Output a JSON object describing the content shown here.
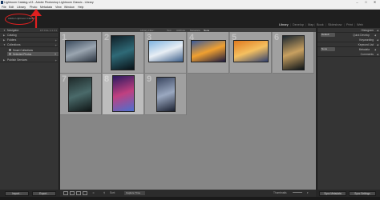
{
  "window": {
    "title": "Lightroom Catalog-v13 - Adobe Photoshop Lightroom Classic - Library",
    "min": "–",
    "max": "□",
    "close": "✕"
  },
  "menu": [
    "File",
    "Edit",
    "Library",
    "Photo",
    "Metadata",
    "View",
    "Window",
    "Help"
  ],
  "identity_plate": {
    "text": "Adobe Lightroom Classic"
  },
  "modules": [
    "Library",
    "Develop",
    "Map",
    "Book",
    "Slideshow",
    "Print",
    "Web"
  ],
  "active_module": "Library",
  "left_panel": {
    "navigator": {
      "label": "Navigator",
      "options": "FIT  FILL  1:1  3:1"
    },
    "catalog": {
      "label": "Catalog"
    },
    "folders": {
      "label": "Folders"
    },
    "collections": {
      "label": "Collections",
      "items": [
        {
          "label": "Smart Collections",
          "count": ""
        },
        {
          "label": "Selected Photos",
          "count": "9"
        }
      ]
    },
    "publish": {
      "label": "Publish Services"
    },
    "import_label": "Import...",
    "export_label": "Export..."
  },
  "filter_bar": {
    "title": "Library Filter :",
    "options": [
      "Text",
      "Attribute",
      "Metadata",
      "None"
    ],
    "active": "None"
  },
  "grid": {
    "cells": [
      {
        "num": "1",
        "palette": [
          "#3a4a5c",
          "#9aa5b0",
          "#2b3440"
        ]
      },
      {
        "num": "2",
        "palette": [
          "#0f1e26",
          "#2f6a77",
          "#081015"
        ]
      },
      {
        "num": "3",
        "palette": [
          "#7fb3e0",
          "#e8eef4",
          "#3d5f8a"
        ]
      },
      {
        "num": "4",
        "palette": [
          "#3a5a9a",
          "#f0a030",
          "#1a1a40"
        ]
      },
      {
        "num": "5",
        "palette": [
          "#e07a20",
          "#f5c060",
          "#304070"
        ]
      },
      {
        "num": "6",
        "palette": [
          "#1a2630",
          "#c8a060",
          "#0a1218"
        ]
      },
      {
        "num": "7",
        "palette": [
          "#1e2a2a",
          "#4a6a6a",
          "#0e1414"
        ]
      },
      {
        "num": "8",
        "palette": [
          "#2a1a60",
          "#c04080",
          "#4a70d0"
        ]
      },
      {
        "num": "9",
        "palette": [
          "#3a4660",
          "#9aa8c0",
          "#1a2030"
        ]
      }
    ],
    "selected": "8"
  },
  "right_panel": {
    "histogram": {
      "label": "Histogram"
    },
    "quick_develop": {
      "label": "Quick Develop",
      "preset": "Default",
      "keywording": "Keywording",
      "keyword_list": "Keyword List",
      "metadata": "Metadata",
      "metadata_preset": "None",
      "comments": "Comments"
    },
    "sync_metadata": "Sync Metadata",
    "sync_settings": "Sync Settings"
  },
  "toolbar": {
    "sort_label": "Sort:",
    "sort_value": "Capture Time",
    "thumbnails": "Thumbnails"
  },
  "colors": {
    "accent": "#e02020",
    "panel": "#343434",
    "grid_bg": "#868686",
    "cell": "#a0a0a0",
    "cell_selected": "#bdbdbd"
  }
}
